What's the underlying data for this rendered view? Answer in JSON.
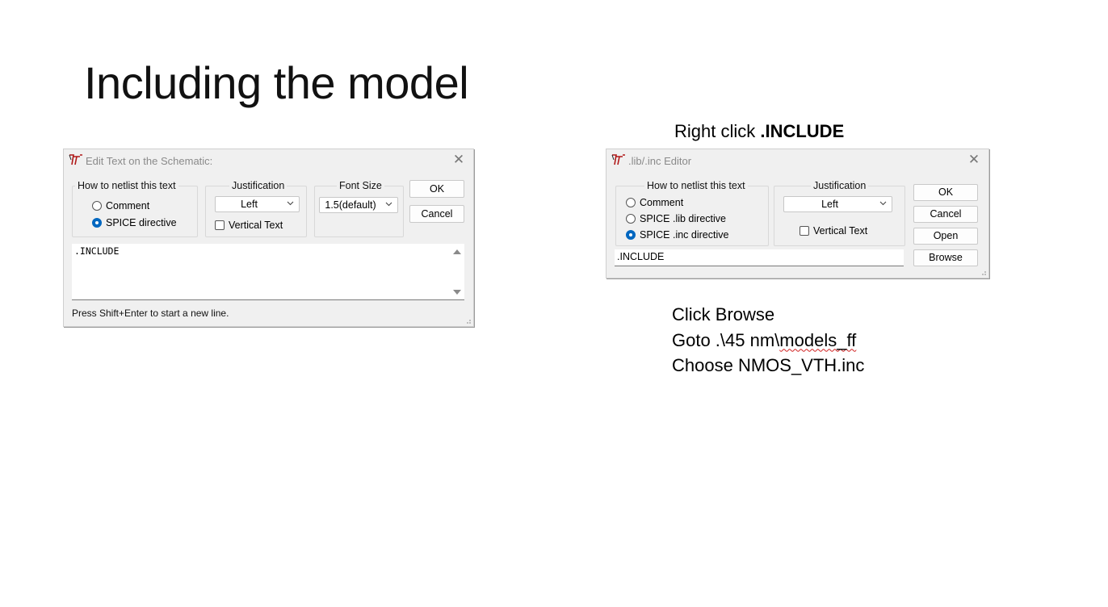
{
  "slide": {
    "title": "Including the model",
    "right_caption_prefix": "Right click ",
    "right_caption_bold": ".INCLUDE",
    "steps": {
      "line1": "Click Browse",
      "line2_prefix": "Goto .\\45 nm\\",
      "line2_squiggle": "models_ff",
      "line3": "Choose NMOS_VTH.inc"
    }
  },
  "dialog_edit_text": {
    "title": "Edit Text on the Schematic:",
    "netlist_group_label": "How to netlist this text",
    "radio_comment": "Comment",
    "radio_spice_directive": "SPICE directive",
    "selected": "SPICE directive",
    "justification_label": "Justification",
    "justification_value": "Left",
    "vertical_text_label": "Vertical Text",
    "vertical_text_checked": false,
    "font_size_label": "Font Size",
    "font_size_value": "1.5(default)",
    "ok_label": "OK",
    "cancel_label": "Cancel",
    "text_value": ".INCLUDE",
    "status_text": "Press Shift+Enter to start a new line."
  },
  "dialog_lib_inc": {
    "title": ".lib/.inc Editor",
    "netlist_group_label": "How to netlist this text",
    "radio_comment": "Comment",
    "radio_spice_lib": "SPICE .lib directive",
    "radio_spice_inc": "SPICE .inc directive",
    "selected": "SPICE .inc directive",
    "justification_label": "Justification",
    "justification_value": "Left",
    "vertical_text_label": "Vertical Text",
    "vertical_text_checked": false,
    "ok_label": "OK",
    "cancel_label": "Cancel",
    "open_label": "Open",
    "browse_label": "Browse",
    "text_value": ".INCLUDE"
  },
  "colors": {
    "dialog_bg": "#f0f0f0",
    "accent_radio": "#0067c0",
    "squiggle": "#d02020"
  }
}
